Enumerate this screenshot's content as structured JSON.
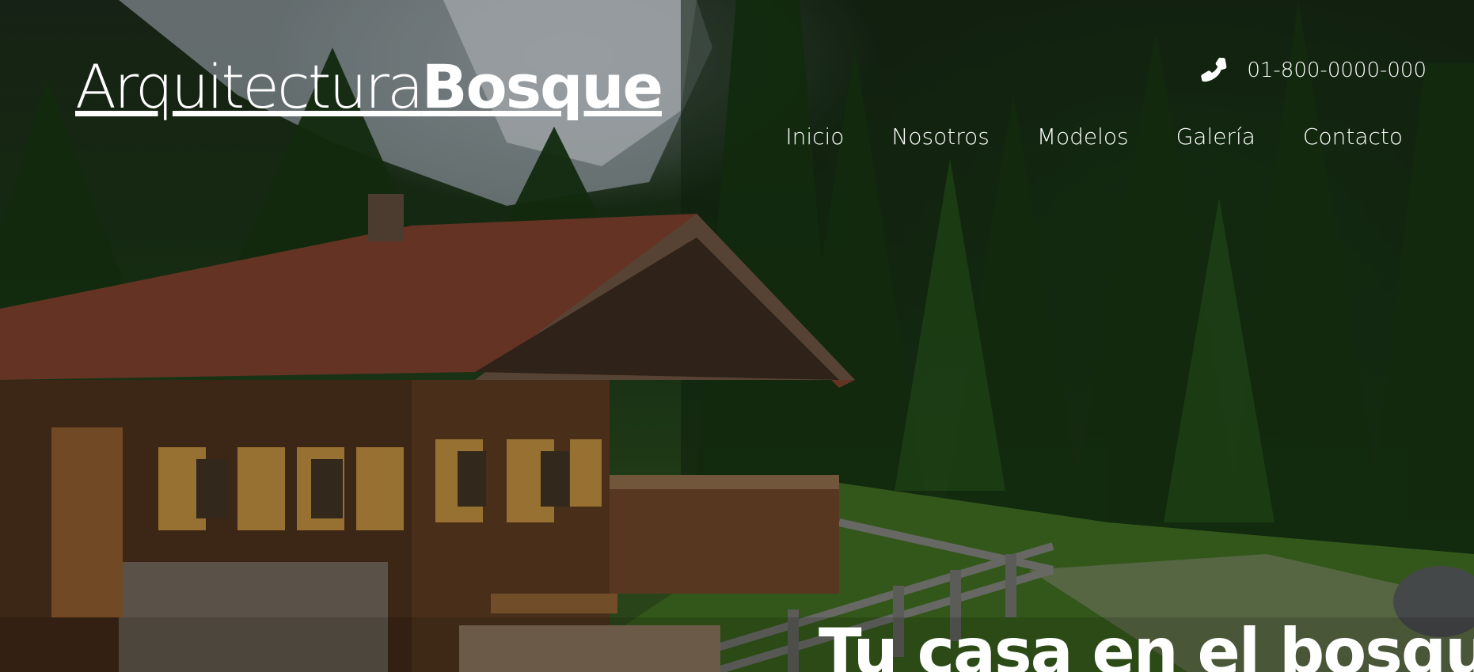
{
  "brand": {
    "name_light": "Arquitectura",
    "name_bold": "Bosque"
  },
  "contact": {
    "icon": "phone-icon",
    "phone": "01-800-0000-000"
  },
  "nav": {
    "items": [
      {
        "label": "Inicio"
      },
      {
        "label": "Nosotros"
      },
      {
        "label": "Modelos"
      },
      {
        "label": "Galería"
      },
      {
        "label": "Contacto"
      }
    ]
  },
  "hero": {
    "headline": "Tu casa en el bosque"
  },
  "colors": {
    "text": "#ffffff",
    "forest": "#1f3d17",
    "roof": "#7a3f2c",
    "wood": "#6b4426"
  }
}
